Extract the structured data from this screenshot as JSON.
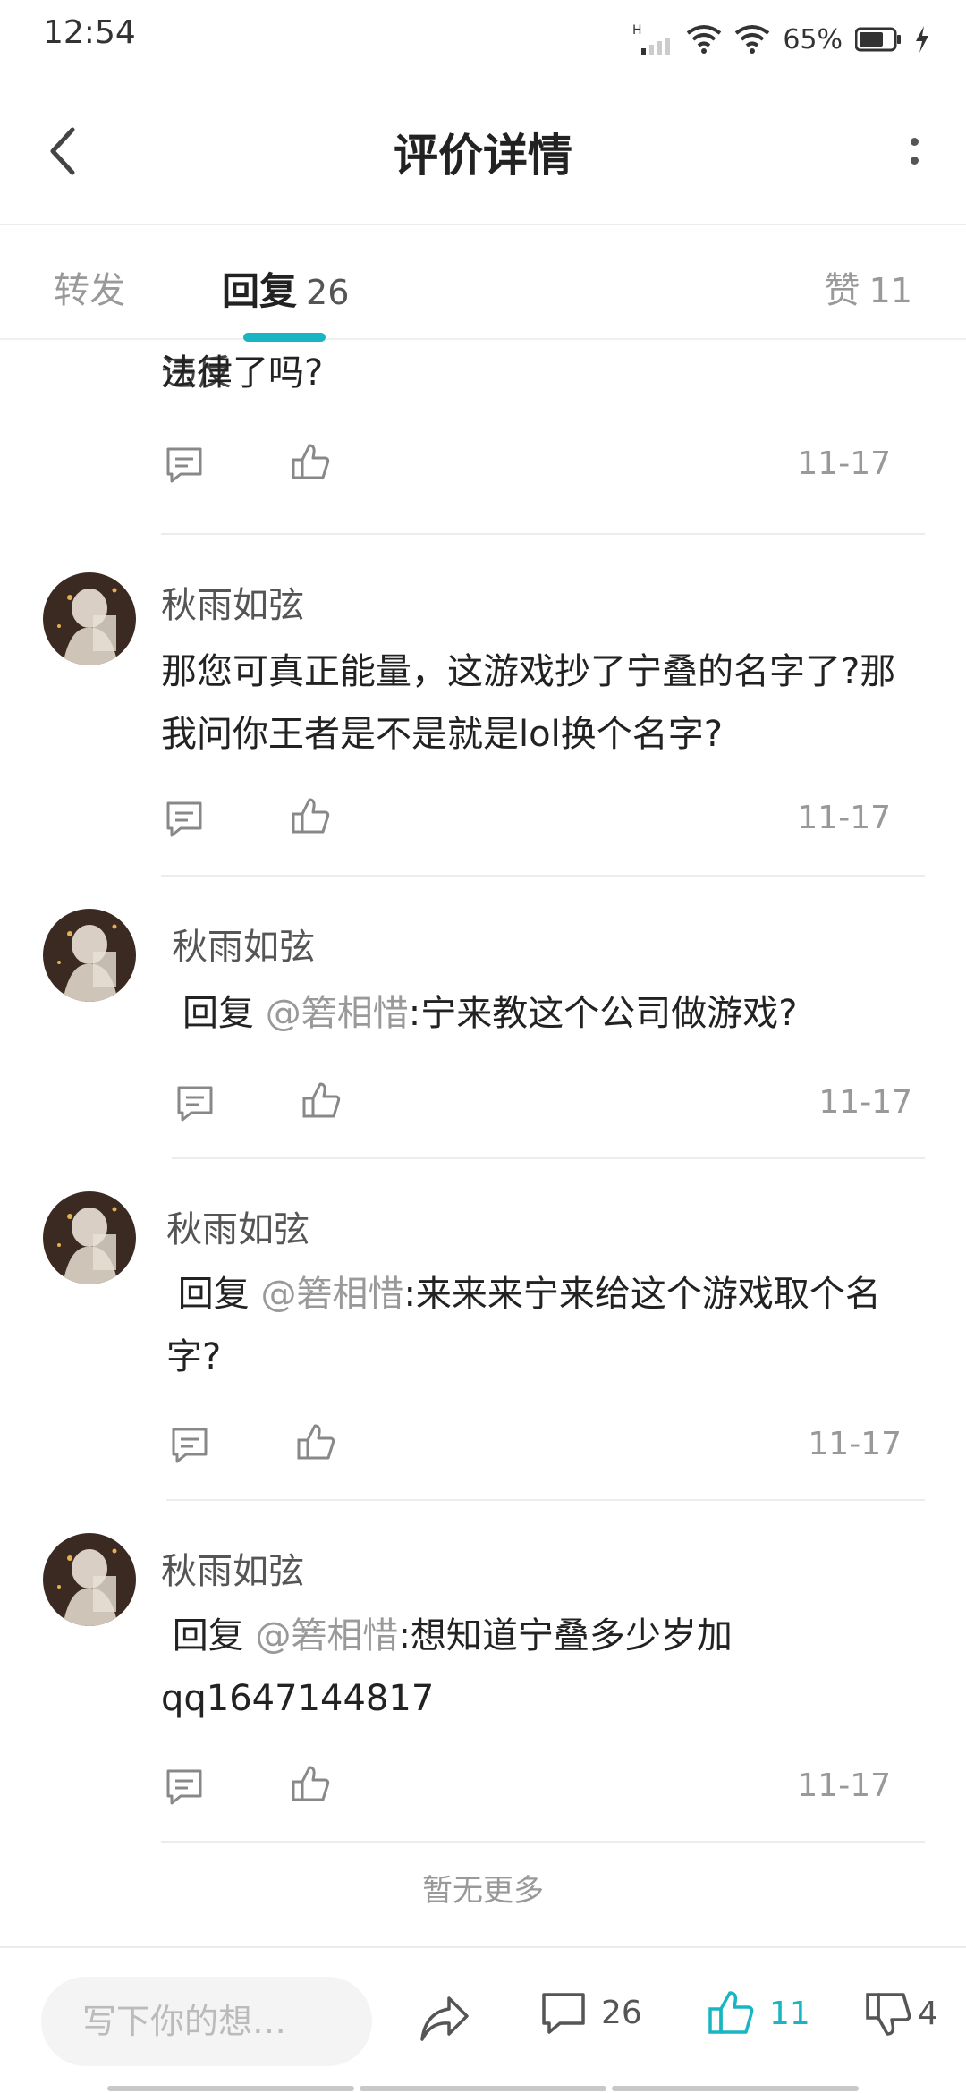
{
  "status_bar": {
    "time": "12:54",
    "network": "H",
    "battery": "65%",
    "icons": [
      "signal-icon",
      "wifi-icon",
      "battery-icon",
      "charging-icon"
    ]
  },
  "header": {
    "title": "评价详情",
    "back_icon": "chevron-left-icon",
    "more_icon": "more-vertical-icon"
  },
  "tabs": {
    "forward": {
      "label": "转发"
    },
    "reply": {
      "label": "回复",
      "count": "26"
    },
    "like": {
      "label": "赞",
      "count": "11"
    },
    "accent_color": "#19b5c3"
  },
  "replies": [
    {
      "username": "",
      "text_partial_top": "回复 @箬相惜:宁来教这个游戏抄了宁叠的名字违反",
      "text": "法律了吗?",
      "date": "11-17"
    },
    {
      "username": "秋雨如弦",
      "text": "那您可真正能量，这游戏抄了宁叠的名字了?那我问你王者是不是就是lol换个名字?",
      "date": "11-17"
    },
    {
      "username": "秋雨如弦",
      "reply_prefix": "回复 ",
      "mention": "@箬相惜",
      "text": ":宁来教这个公司做游戏?",
      "date": "11-17"
    },
    {
      "username": "秋雨如弦",
      "reply_prefix": "回复 ",
      "mention": "@箬相惜",
      "text": ":来来来宁来给这个游戏取个名字?",
      "date": "11-17"
    },
    {
      "username": "秋雨如弦",
      "reply_prefix": "回复 ",
      "mention": "@箬相惜",
      "text": ":想知道宁叠多少岁加qq1647144817",
      "date": "11-17"
    }
  ],
  "no_more": "暂无更多",
  "bottom_bar": {
    "input_placeholder": "写下你的想…",
    "comment_count": "26",
    "like_count": "11",
    "dislike_count": "4",
    "icons": [
      "share-icon",
      "comment-icon",
      "thumbs-up-icon",
      "thumbs-down-icon"
    ]
  }
}
